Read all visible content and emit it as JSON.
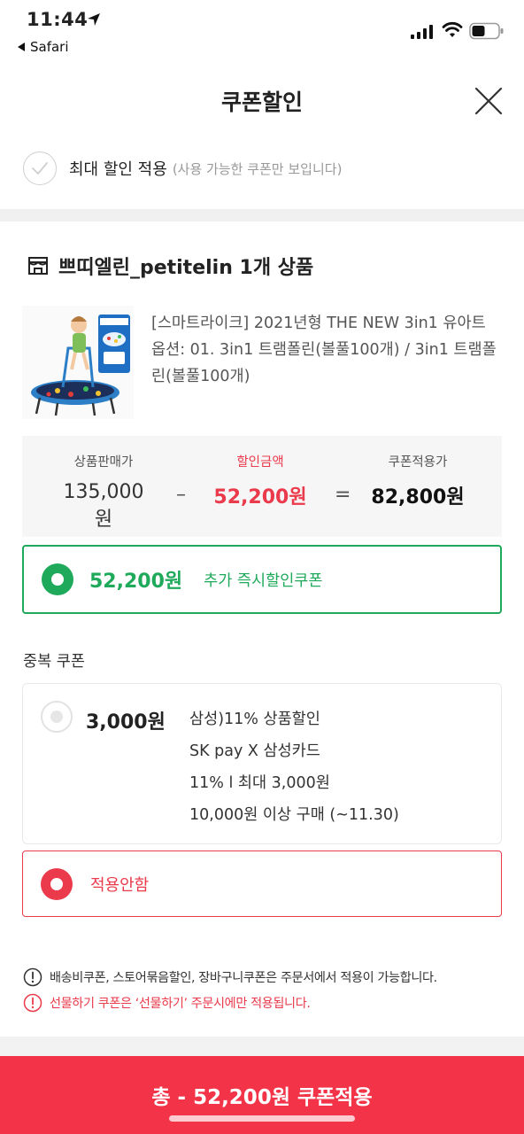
{
  "status_bar": {
    "time": "11:44",
    "back_app": "Safari",
    "icons": [
      "location-arrow-icon",
      "signal-icon",
      "wifi-icon",
      "battery-icon"
    ]
  },
  "header": {
    "title": "쿠폰할인",
    "close_icon": "close-icon"
  },
  "max_discount": {
    "label": "최대 할인 적용",
    "sub": "(사용 가능한 쿠폰만 보입니다)"
  },
  "seller": {
    "name": "쁘띠엘린_petitelin 1개 상품"
  },
  "product": {
    "name": "[스마트라이크] 2021년형 THE NEW 3in1 유아트",
    "option_line1": "옵션: 01. 3in1 트램폴린(볼풀100개) / 3in1 트램폴",
    "option_line2": "린(볼풀100개)",
    "image": "trampoline product photo"
  },
  "price": {
    "sale_label": "상품판매가",
    "sale_value": "135,000원",
    "discount_label": "할인금액",
    "discount_value": "52,200원",
    "final_label": "쿠폰적용가",
    "final_value": "82,800원",
    "minus": "–",
    "equals": "="
  },
  "coupon_main": {
    "amount": "52,200원",
    "desc": "추가 즉시할인쿠폰",
    "selected": true
  },
  "duplicate": {
    "title": "중복 쿠폰",
    "amount": "3,000원",
    "lines": [
      "삼성)11% 상품할인",
      "SK pay X 삼성카드",
      "11% l 최대 3,000원",
      "10,000원 이상 구매 (~11.30)"
    ],
    "selected": false
  },
  "not_apply": {
    "label": "적용안함",
    "selected": true
  },
  "notices": [
    "배송비쿠폰, 스토어묶음할인, 장바구니쿠폰은 주문서에서 적용이 가능합니다.",
    "선물하기 쿠폰은 ‘선물하기’ 주문시에만 적용됩니다."
  ],
  "apply_button": {
    "label": "총 - 52,200원 쿠폰적용"
  },
  "colors": {
    "green": "#1faa5b",
    "red": "#ea3a4b",
    "button": "#f23348"
  }
}
